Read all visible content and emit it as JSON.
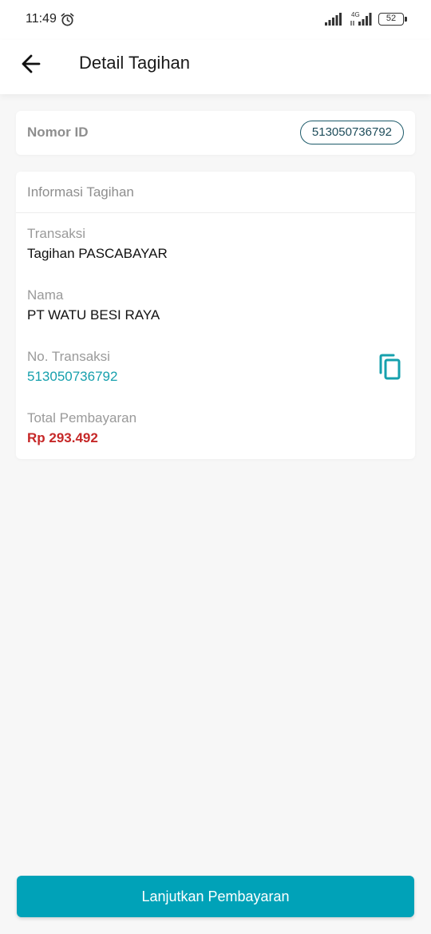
{
  "status_bar": {
    "time": "11:49",
    "network_label": "4G",
    "battery": "52",
    "icons": [
      "alarm-icon",
      "signal-icon",
      "signal-4g-icon",
      "battery-icon"
    ]
  },
  "header": {
    "title": "Detail Tagihan",
    "back_icon": "arrow-left-icon"
  },
  "id_card": {
    "label": "Nomor ID",
    "value": "513050736792"
  },
  "info_card": {
    "title": "Informasi Tagihan",
    "fields": [
      {
        "label": "Transaksi",
        "value": "Tagihan PASCABAYAR"
      },
      {
        "label": "Nama",
        "value": "PT WATU BESI RAYA"
      },
      {
        "label": "No. Transaksi",
        "value": "513050736792"
      },
      {
        "label": "Total Pembayaran",
        "value": "Rp 293.492"
      }
    ],
    "copy_icon": "copy-icon"
  },
  "footer": {
    "button_label": "Lanjutkan Pembayaran"
  },
  "colors": {
    "accent": "#00a2b8",
    "link_teal": "#16a0ad",
    "total_red": "#c62828",
    "pill_border": "#1d5a6a"
  }
}
